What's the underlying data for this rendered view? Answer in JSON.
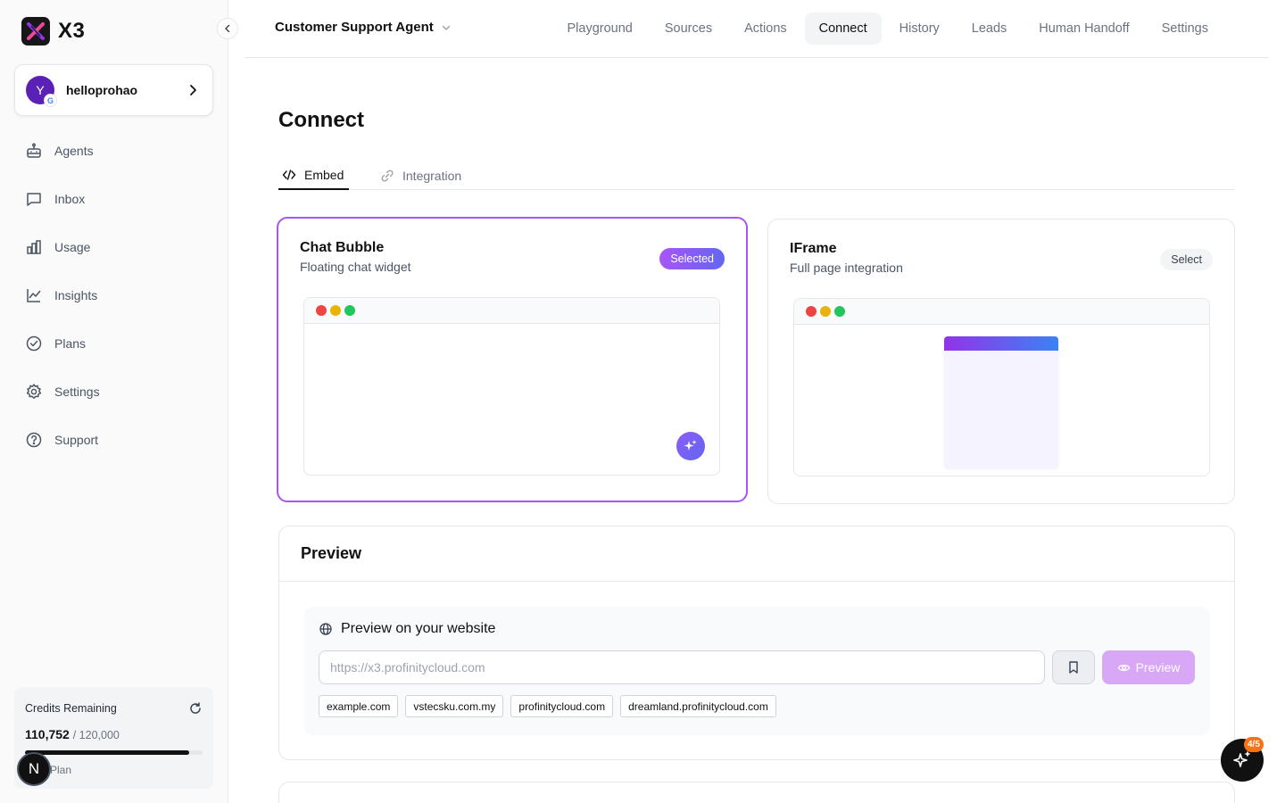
{
  "app": {
    "name": "X3"
  },
  "account": {
    "avatar_letter": "Y",
    "name": "helloprohao"
  },
  "sidebar": {
    "items": [
      {
        "label": "Agents",
        "icon": "robot-icon"
      },
      {
        "label": "Inbox",
        "icon": "message-icon"
      },
      {
        "label": "Usage",
        "icon": "bar-chart-icon"
      },
      {
        "label": "Insights",
        "icon": "line-chart-icon"
      },
      {
        "label": "Plans",
        "icon": "check-circle-icon"
      },
      {
        "label": "Settings",
        "icon": "gear-icon"
      },
      {
        "label": "Support",
        "icon": "help-circle-icon"
      }
    ]
  },
  "credits": {
    "label": "Credits Remaining",
    "remaining": "110,752",
    "total": "/ 120,000",
    "fraction_remaining": 0.923,
    "plan": "Plan"
  },
  "avatar_badge": "N",
  "topbar": {
    "agent_name": "Customer Support Agent",
    "tabs": [
      "Playground",
      "Sources",
      "Actions",
      "Connect",
      "History",
      "Leads",
      "Human Handoff",
      "Settings"
    ],
    "active_tab": "Connect"
  },
  "page": {
    "title": "Connect",
    "subtabs": [
      "Embed",
      "Integration"
    ],
    "active_subtab": "Embed"
  },
  "cards": {
    "chat_bubble": {
      "title": "Chat Bubble",
      "subtitle": "Floating chat widget",
      "status": "Selected"
    },
    "iframe": {
      "title": "IFrame",
      "subtitle": "Full page integration",
      "status": "Select"
    }
  },
  "preview": {
    "title": "Preview",
    "subtitle": "Preview on your website",
    "url_placeholder": "https://x3.profinitycloud.com",
    "button_label": "Preview",
    "chips": [
      "example.com",
      "vstecsku.com.my",
      "profinitycloud.com",
      "dreamland.profinitycloud.com"
    ]
  },
  "assistant": {
    "badge": "4/5"
  },
  "colors": {
    "accent_purple": "#a855f7",
    "accent_indigo": "#6366f1",
    "dot_red": "#ef4444",
    "dot_yellow": "#eab308",
    "dot_green": "#22c55e"
  }
}
